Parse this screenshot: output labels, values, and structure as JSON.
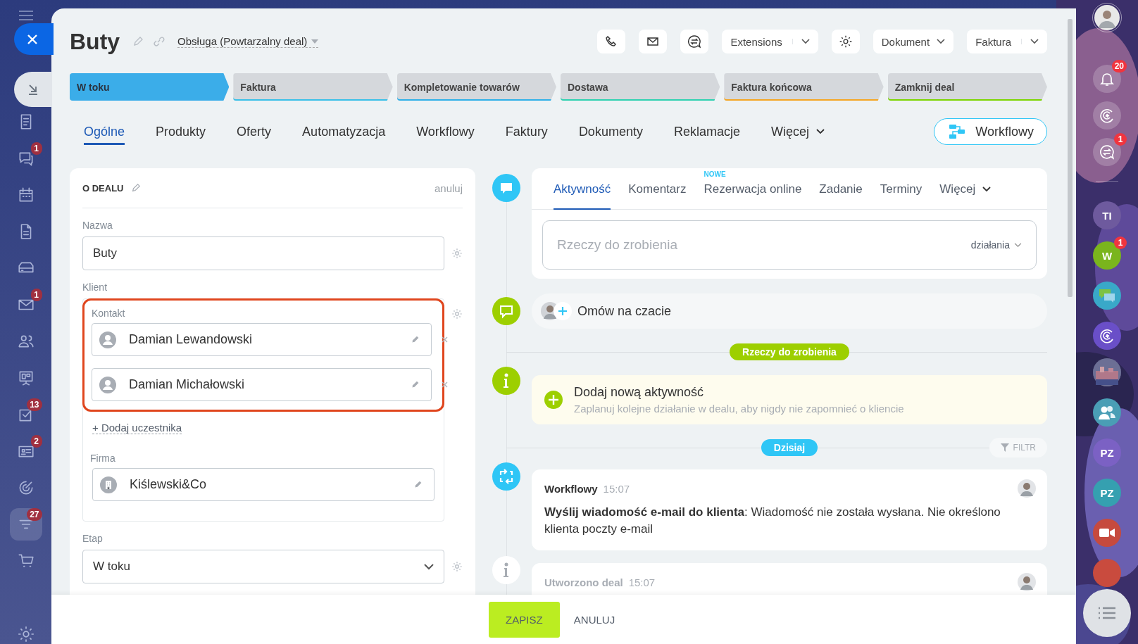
{
  "left_nav": [
    {
      "kind": "document",
      "selected": false
    },
    {
      "kind": "chat",
      "badge": "1",
      "selected": false
    },
    {
      "kind": "calendar",
      "selected": false
    },
    {
      "kind": "file",
      "selected": false
    },
    {
      "kind": "drive",
      "selected": false
    },
    {
      "kind": "mail",
      "badge": "1",
      "selected": false
    },
    {
      "kind": "people",
      "selected": false
    },
    {
      "kind": "board",
      "selected": false
    },
    {
      "kind": "tasks",
      "badge": "13",
      "selected": false
    },
    {
      "kind": "contact",
      "badge": "2",
      "selected": false
    },
    {
      "kind": "target",
      "selected": false
    },
    {
      "kind": "funnel",
      "badge": "27",
      "selected": true
    },
    {
      "kind": "cart",
      "selected": false
    }
  ],
  "deal": {
    "title": "Buty",
    "category": "Obsługa (Powtarzalny deal)"
  },
  "header_buttons": [
    {
      "label": "Extensions",
      "split": true
    },
    {
      "label": "Dokument",
      "split": false
    },
    {
      "label": "Faktura",
      "split": true
    }
  ],
  "stages": [
    {
      "label": "W toku",
      "selected": true,
      "color": "#3bade9"
    },
    {
      "label": "Faktura",
      "selected": false,
      "color": "#39c0e8"
    },
    {
      "label": "Kompletowanie towarów",
      "selected": false,
      "color": "#2fb0e8"
    },
    {
      "label": "Dostawa",
      "selected": false,
      "color": "#2ed1b0"
    },
    {
      "label": "Faktura końcowa",
      "selected": false,
      "color": "#f5a623"
    },
    {
      "label": "Zamknij deal",
      "selected": false,
      "color": "#7bd500"
    }
  ],
  "tabs": [
    {
      "label": "Ogólne",
      "selected": true,
      "dropdown": false
    },
    {
      "label": "Produkty",
      "selected": false,
      "dropdown": false
    },
    {
      "label": "Oferty",
      "selected": false,
      "dropdown": false
    },
    {
      "label": "Automatyzacja",
      "selected": false,
      "dropdown": false
    },
    {
      "label": "Workflowy",
      "selected": false,
      "dropdown": false
    },
    {
      "label": "Faktury",
      "selected": false,
      "dropdown": false
    },
    {
      "label": "Dokumenty",
      "selected": false,
      "dropdown": false
    },
    {
      "label": "Reklamacje",
      "selected": false,
      "dropdown": false
    },
    {
      "label": "Więcej",
      "selected": false,
      "dropdown": true
    }
  ],
  "workflow_button": "Workflowy",
  "about": {
    "title": "O DEALU",
    "cancel": "anuluj",
    "name": {
      "label": "Nazwa",
      "value": "Buty"
    },
    "client": {
      "label": "Klient",
      "group_label": "Kontakt",
      "highlighted": true,
      "contacts": [
        {
          "name": "Damian Lewandowski"
        },
        {
          "name": "Damian Michałowski"
        }
      ],
      "add_label": "+ Dodaj uczestnika",
      "company": {
        "label": "Firma",
        "name": "Kiślewski&Co"
      }
    },
    "stage": {
      "label": "Etap",
      "value": "W toku"
    }
  },
  "timeline": [
    {
      "kind": "composer",
      "tabs": [
        {
          "label": "Aktywność",
          "selected": true
        },
        {
          "label": "Komentarz",
          "selected": false
        },
        {
          "label": "Rezerwacja online",
          "selected": false,
          "badge": "NOWE"
        },
        {
          "label": "Zadanie",
          "selected": false
        },
        {
          "label": "Terminy",
          "selected": false
        },
        {
          "label": "Więcej",
          "selected": false
        }
      ],
      "placeholder": "Rzeczy do zrobienia",
      "actions": "działania"
    },
    {
      "kind": "chat",
      "text": "Omów na czacie"
    },
    {
      "kind": "divider",
      "label": "Rzeczy do zrobienia",
      "color": "#9dcf00"
    },
    {
      "kind": "add",
      "title": "Dodaj nową aktywność",
      "subtitle": "Zaplanuj kolejne działanie w dealu, aby nigdy nie zapomnieć o kliencie"
    },
    {
      "kind": "divider",
      "label": "Dzisiaj",
      "color": "#2fc6f6",
      "filter": "FILTR"
    },
    {
      "kind": "workflow",
      "faded": false,
      "title": "Workflowy",
      "time": "15:07",
      "text": "**Wyślij wiadomość e-mail do klienta**: Wiadomość nie została wysłana. Nie określono klienta poczty e-mail"
    },
    {
      "kind": "created",
      "faded": true,
      "title": "Utworzono deal",
      "time": "15:07"
    }
  ],
  "footer": {
    "save": "ZAPISZ",
    "cancel": "ANULUJ"
  },
  "right_rail": [
    {
      "kind": "avatar"
    },
    {
      "kind": "bell",
      "badge": "20"
    },
    {
      "kind": "copilot"
    },
    {
      "kind": "chat",
      "badge": "1"
    },
    {
      "kind": "separator"
    },
    {
      "kind": "initials",
      "text": "TI",
      "color": "#6e5a9e"
    },
    {
      "kind": "initials",
      "text": "W",
      "color": "#7ab51d",
      "badge": "1"
    },
    {
      "kind": "bubbles",
      "color": "#39a8c8"
    },
    {
      "kind": "copilot",
      "color": "#6a4fc8"
    },
    {
      "kind": "picture"
    },
    {
      "kind": "people",
      "color": "#4a9eb5"
    },
    {
      "kind": "initials",
      "text": "PZ",
      "color": "#7b61c4"
    },
    {
      "kind": "initials",
      "text": "PZ",
      "color": "#35a0b0"
    },
    {
      "kind": "video",
      "color": "#c64a3e"
    },
    {
      "kind": "blank",
      "color": "#c94b3e"
    }
  ]
}
